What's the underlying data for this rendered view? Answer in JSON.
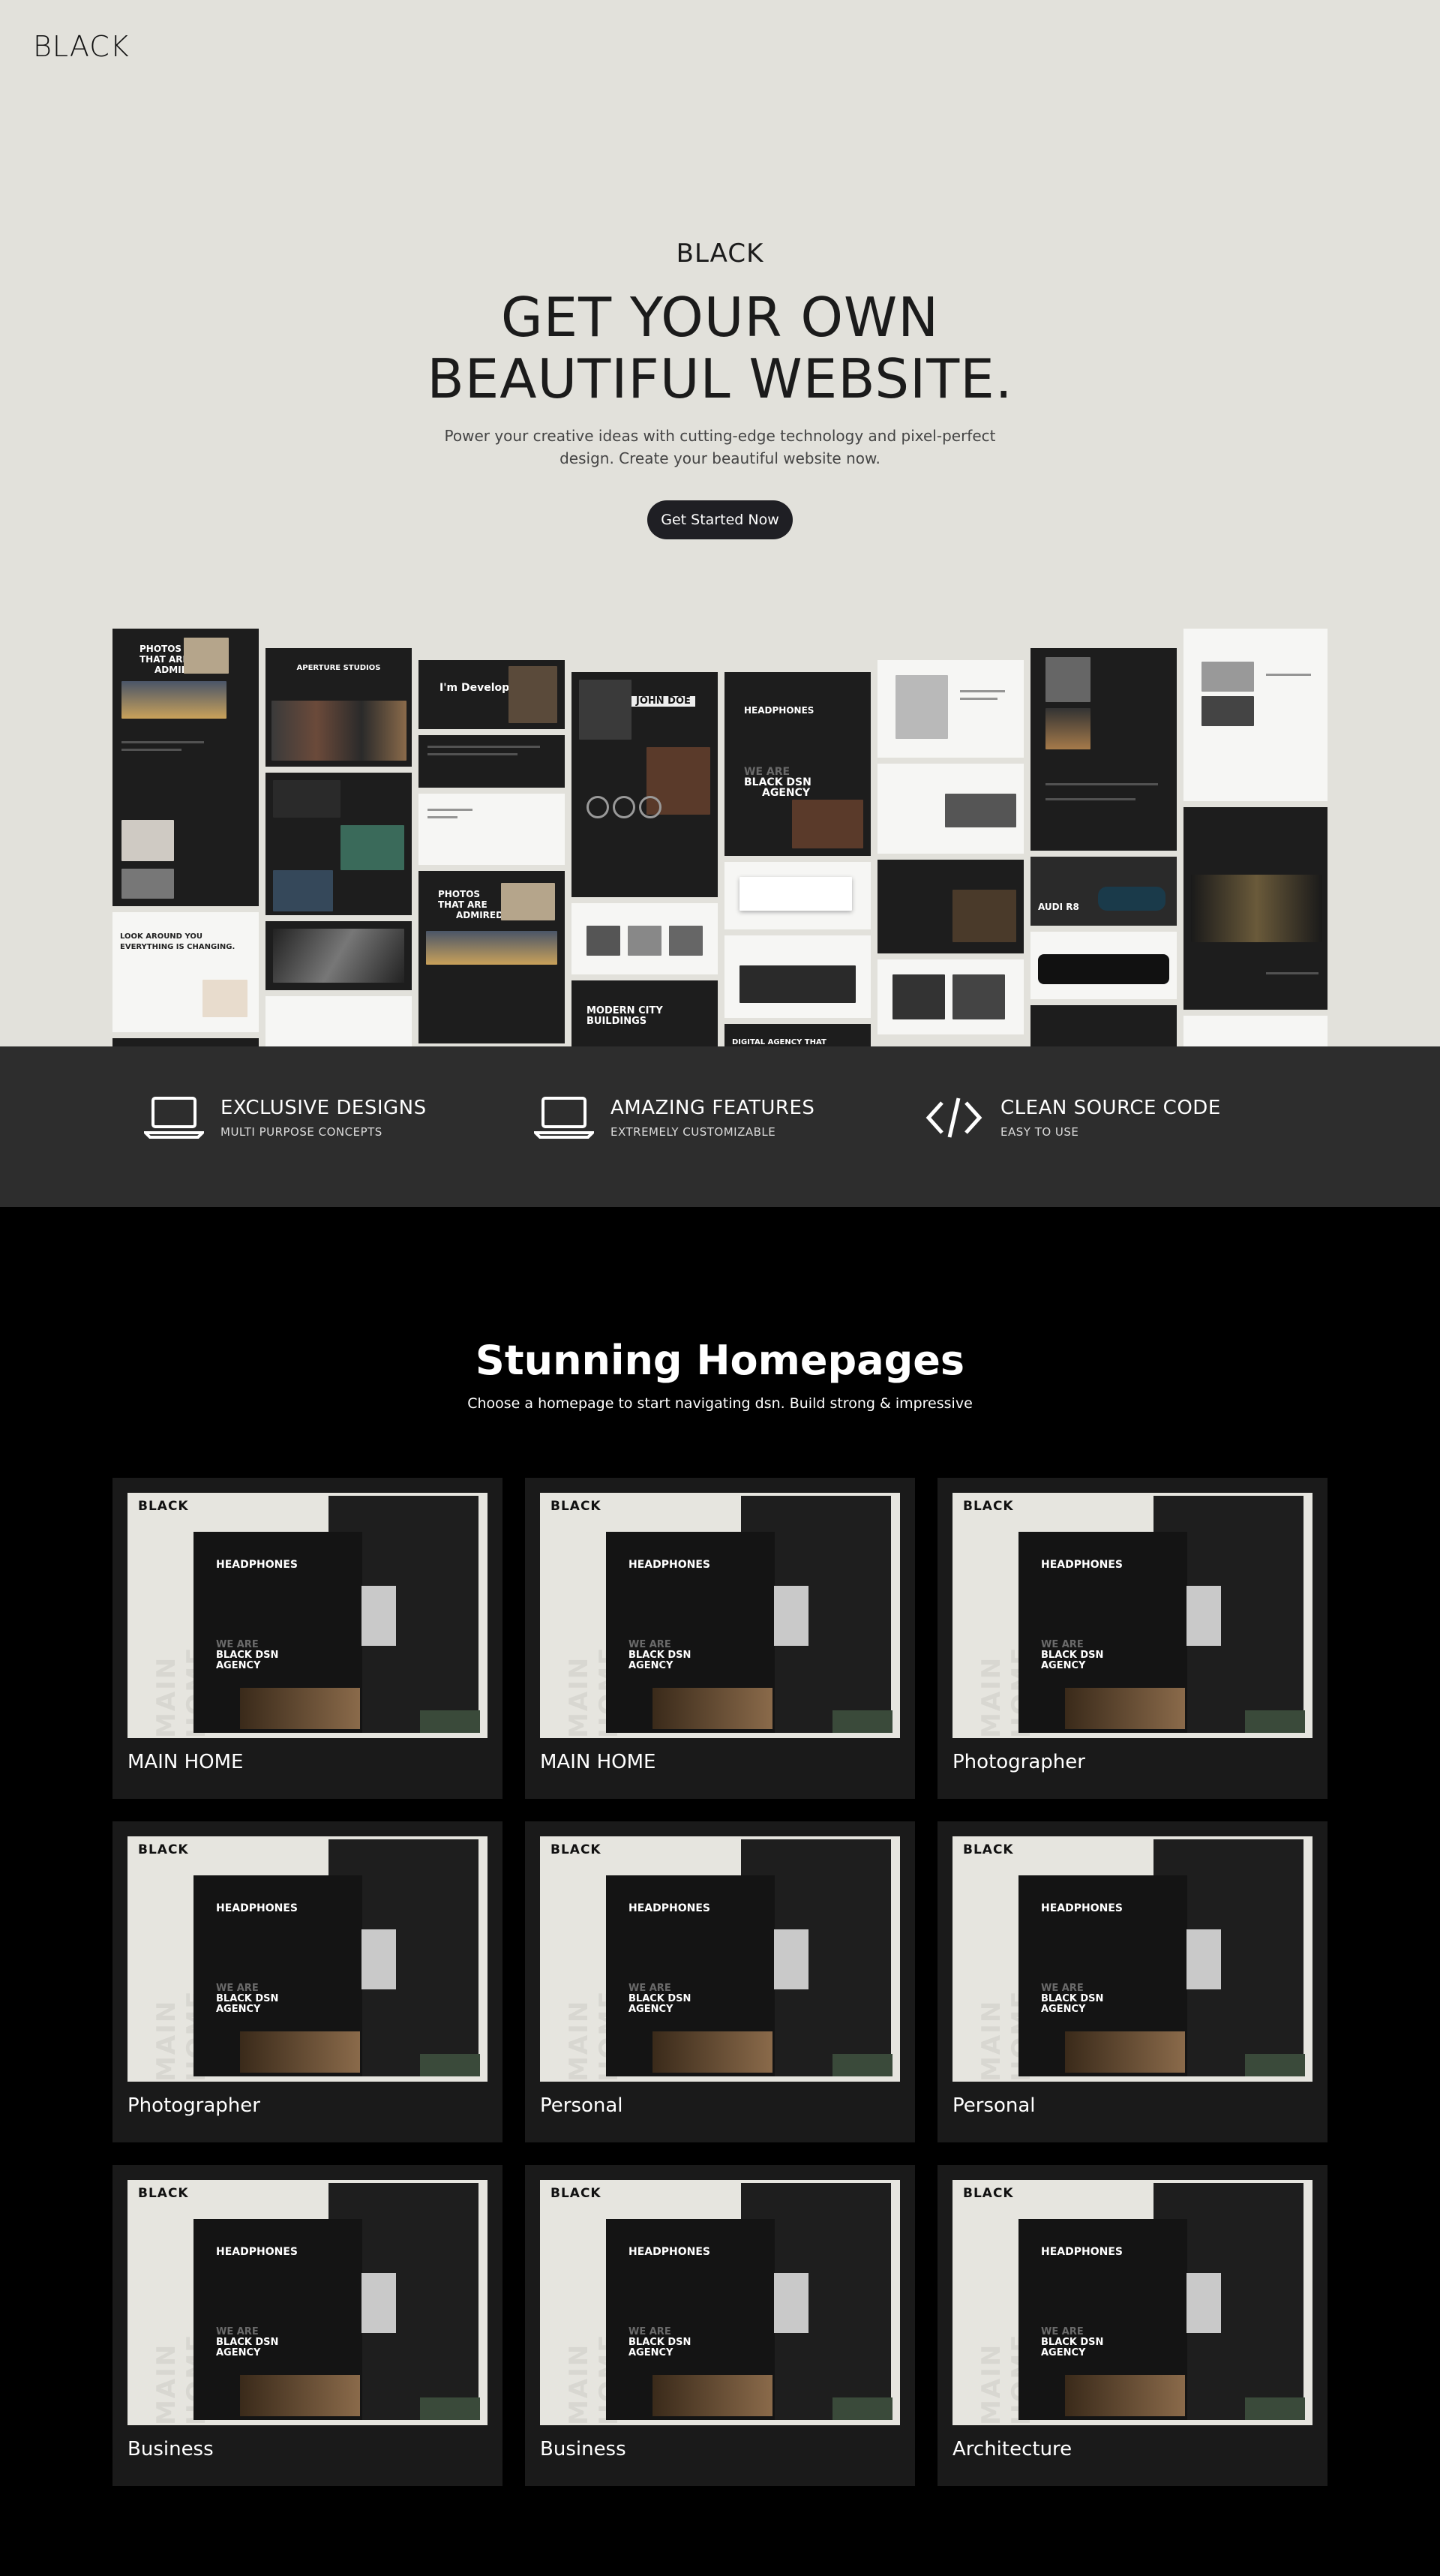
{
  "header": {
    "logo": "BLACK"
  },
  "hero": {
    "brand": "BLACK",
    "title": "GET YOUR OWN BEAUTIFUL WEBSITE.",
    "subtitle": "Power your creative ideas with cutting-edge technology and pixel-perfect design. Create your beautiful website now.",
    "cta": "Get Started Now"
  },
  "collage": {
    "texts": [
      "PHOTOS",
      "THAT ARE",
      "ADMIRED",
      "APERTURE STUDIOS",
      "I'm Developer",
      "JOHN DOE",
      "HEADPHONES",
      "WE ARE",
      "BLACK DSN",
      "AGENCY",
      "AUDI R8",
      "MODERN CITY",
      "BUILDINGS",
      "LOOK AROUND YOU",
      "EVERYTHING IS CHANGING.",
      "DIGITAL AGENCY THAT"
    ]
  },
  "features": [
    {
      "icon": "laptop-icon",
      "title": "EXCLUSIVE DESIGNS",
      "subtitle": "MULTI PURPOSE CONCEPTS"
    },
    {
      "icon": "laptop-icon",
      "title": "AMAZING FEATURES",
      "subtitle": "EXTREMELY CUSTOMIZABLE"
    },
    {
      "icon": "code-icon",
      "title": "CLEAN SOURCE CODE",
      "subtitle": "EASY TO USE"
    }
  ],
  "homepages": {
    "title": "Stunning Homepages",
    "subtitle": "Choose a homepage to start navigating dsn. Build strong & impressive",
    "preview": {
      "logo": "BLACK",
      "vertical": "MAIN HOME",
      "headline": "HEADPHONES",
      "we_are": "WE ARE",
      "agency_1": "BLACK DSN",
      "agency_2": "AGENCY"
    },
    "cards": [
      {
        "label": "MAIN HOME"
      },
      {
        "label": "MAIN HOME"
      },
      {
        "label": "Photographer"
      },
      {
        "label": "Photographer"
      },
      {
        "label": "Personal"
      },
      {
        "label": "Personal"
      },
      {
        "label": "Business"
      },
      {
        "label": "Business"
      },
      {
        "label": "Architecture"
      }
    ]
  },
  "colors": {
    "hero_bg": "#e2e1db",
    "strip_bg": "#2d2d2d",
    "page_bg": "#000000",
    "card_bg": "#1a1a1a",
    "button_bg": "#1f1f24"
  }
}
